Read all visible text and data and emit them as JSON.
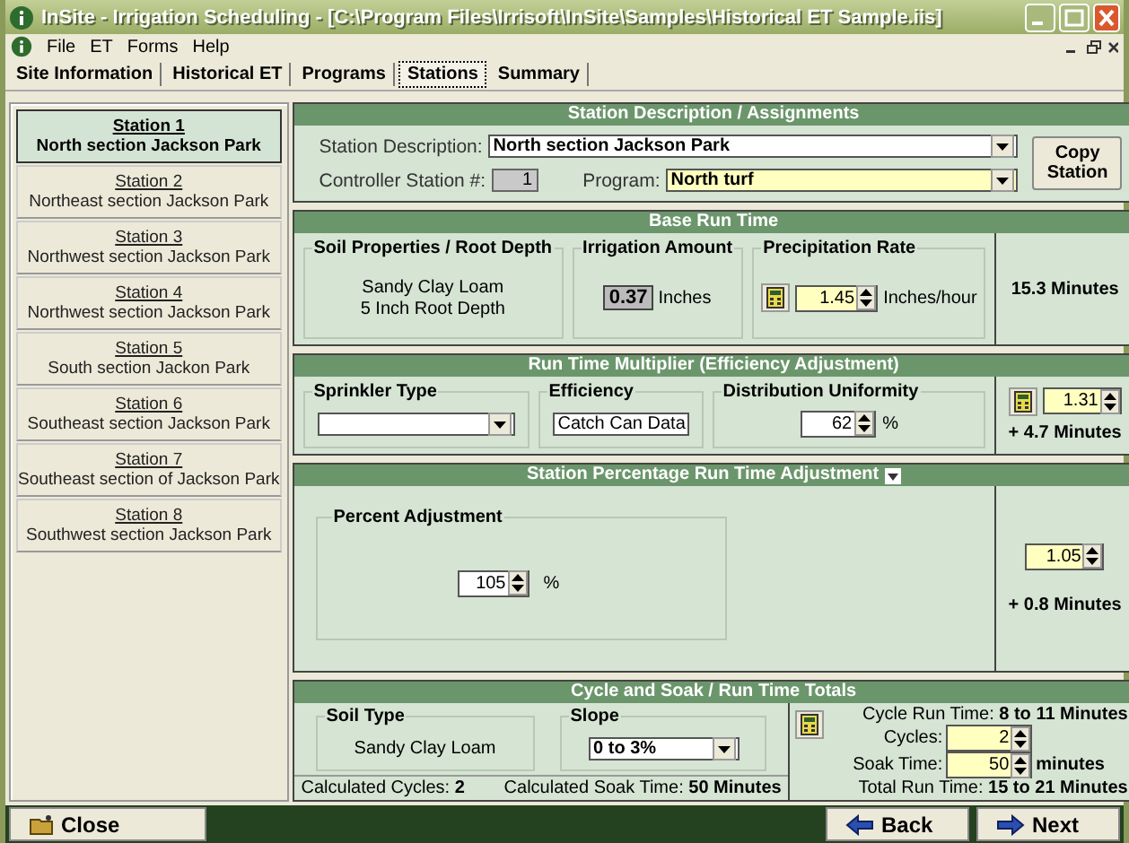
{
  "window": {
    "title": "InSite - Irrigation Scheduling - [C:\\Program Files\\Irrisoft\\InSite\\Samples\\Historical ET Sample.iis]"
  },
  "menu": [
    "File",
    "ET",
    "Forms",
    "Help"
  ],
  "tabs": [
    {
      "label": "Site Information",
      "selected": false
    },
    {
      "label": "Historical ET",
      "selected": false
    },
    {
      "label": "Programs",
      "selected": false
    },
    {
      "label": "Stations",
      "selected": true
    },
    {
      "label": "Summary",
      "selected": false
    }
  ],
  "stations": [
    {
      "name": "Station 1",
      "description": "North section Jackson Park",
      "selected": true
    },
    {
      "name": "Station 2",
      "description": "Northeast section Jackson Park",
      "selected": false
    },
    {
      "name": "Station 3",
      "description": "Northwest section Jackson Park",
      "selected": false
    },
    {
      "name": "Station 4",
      "description": "Northwest section Jackson Park",
      "selected": false
    },
    {
      "name": "Station 5",
      "description": "South section Jackon Park",
      "selected": false
    },
    {
      "name": "Station 6",
      "description": "Southeast section Jackson Park",
      "selected": false
    },
    {
      "name": "Station 7",
      "description": "Southeast section of Jackson Park",
      "selected": false
    },
    {
      "name": "Station 8",
      "description": "Southwest section Jackson Park",
      "selected": false
    }
  ],
  "assignments": {
    "title": "Station Description / Assignments",
    "description_label": "Station Description:",
    "description": "North section Jackson Park",
    "controller_label": "Controller Station #:",
    "controller_station": "1",
    "program_label": "Program:",
    "program": "North turf",
    "copy_button": "Copy Station"
  },
  "base_run_time": {
    "title": "Base Run Time",
    "soil_title": "Soil Properties / Root Depth",
    "soil_lines": [
      "Sandy Clay Loam",
      "5 Inch Root Depth"
    ],
    "irrigation_title": "Irrigation Amount",
    "irrigation_value": "0.37",
    "irrigation_unit": "Inches",
    "precip_title": "Precipitation Rate",
    "precip_value": "1.45",
    "precip_unit": "Inches/hour",
    "result": "15.3 Minutes"
  },
  "multiplier": {
    "title": "Run Time Multiplier (Efficiency Adjustment)",
    "sprinkler_title": "Sprinkler Type",
    "efficiency_title": "Efficiency",
    "efficiency_value": "Catch Can Data",
    "du_title": "Distribution Uniformity",
    "du_value": "62",
    "du_unit": "%",
    "factor": "1.31",
    "result": "+ 4.7 Minutes"
  },
  "percentage": {
    "title": "Station Percentage Run Time Adjustment",
    "percent_title": "Percent Adjustment",
    "percent_value": "105",
    "percent_unit": "%",
    "factor": "1.05",
    "result": "+ 0.8 Minutes"
  },
  "cycle_soak": {
    "title": "Cycle and Soak / Run Time Totals",
    "soil_title": "Soil Type",
    "soil_value": "Sandy Clay Loam",
    "slope_title": "Slope",
    "slope_value": "0 to 3%",
    "calc_cycles_label": "Calculated Cycles:",
    "calc_cycles": "2",
    "calc_soak_label": "Calculated Soak Time:",
    "calc_soak": "50 Minutes",
    "cycle_run_label": "Cycle Run Time:",
    "cycle_run": "8 to 11 Minutes",
    "cycles_label": "Cycles:",
    "cycles": "2",
    "soak_label": "Soak Time:",
    "soak": "50",
    "soak_unit": "minutes",
    "total_label": "Total Run Time:",
    "total": "15 to 21 Minutes"
  },
  "footer": [
    {
      "kind": "close",
      "label": "Close"
    },
    {
      "kind": "back",
      "label": "Back"
    },
    {
      "kind": "next",
      "label": "Next"
    }
  ]
}
